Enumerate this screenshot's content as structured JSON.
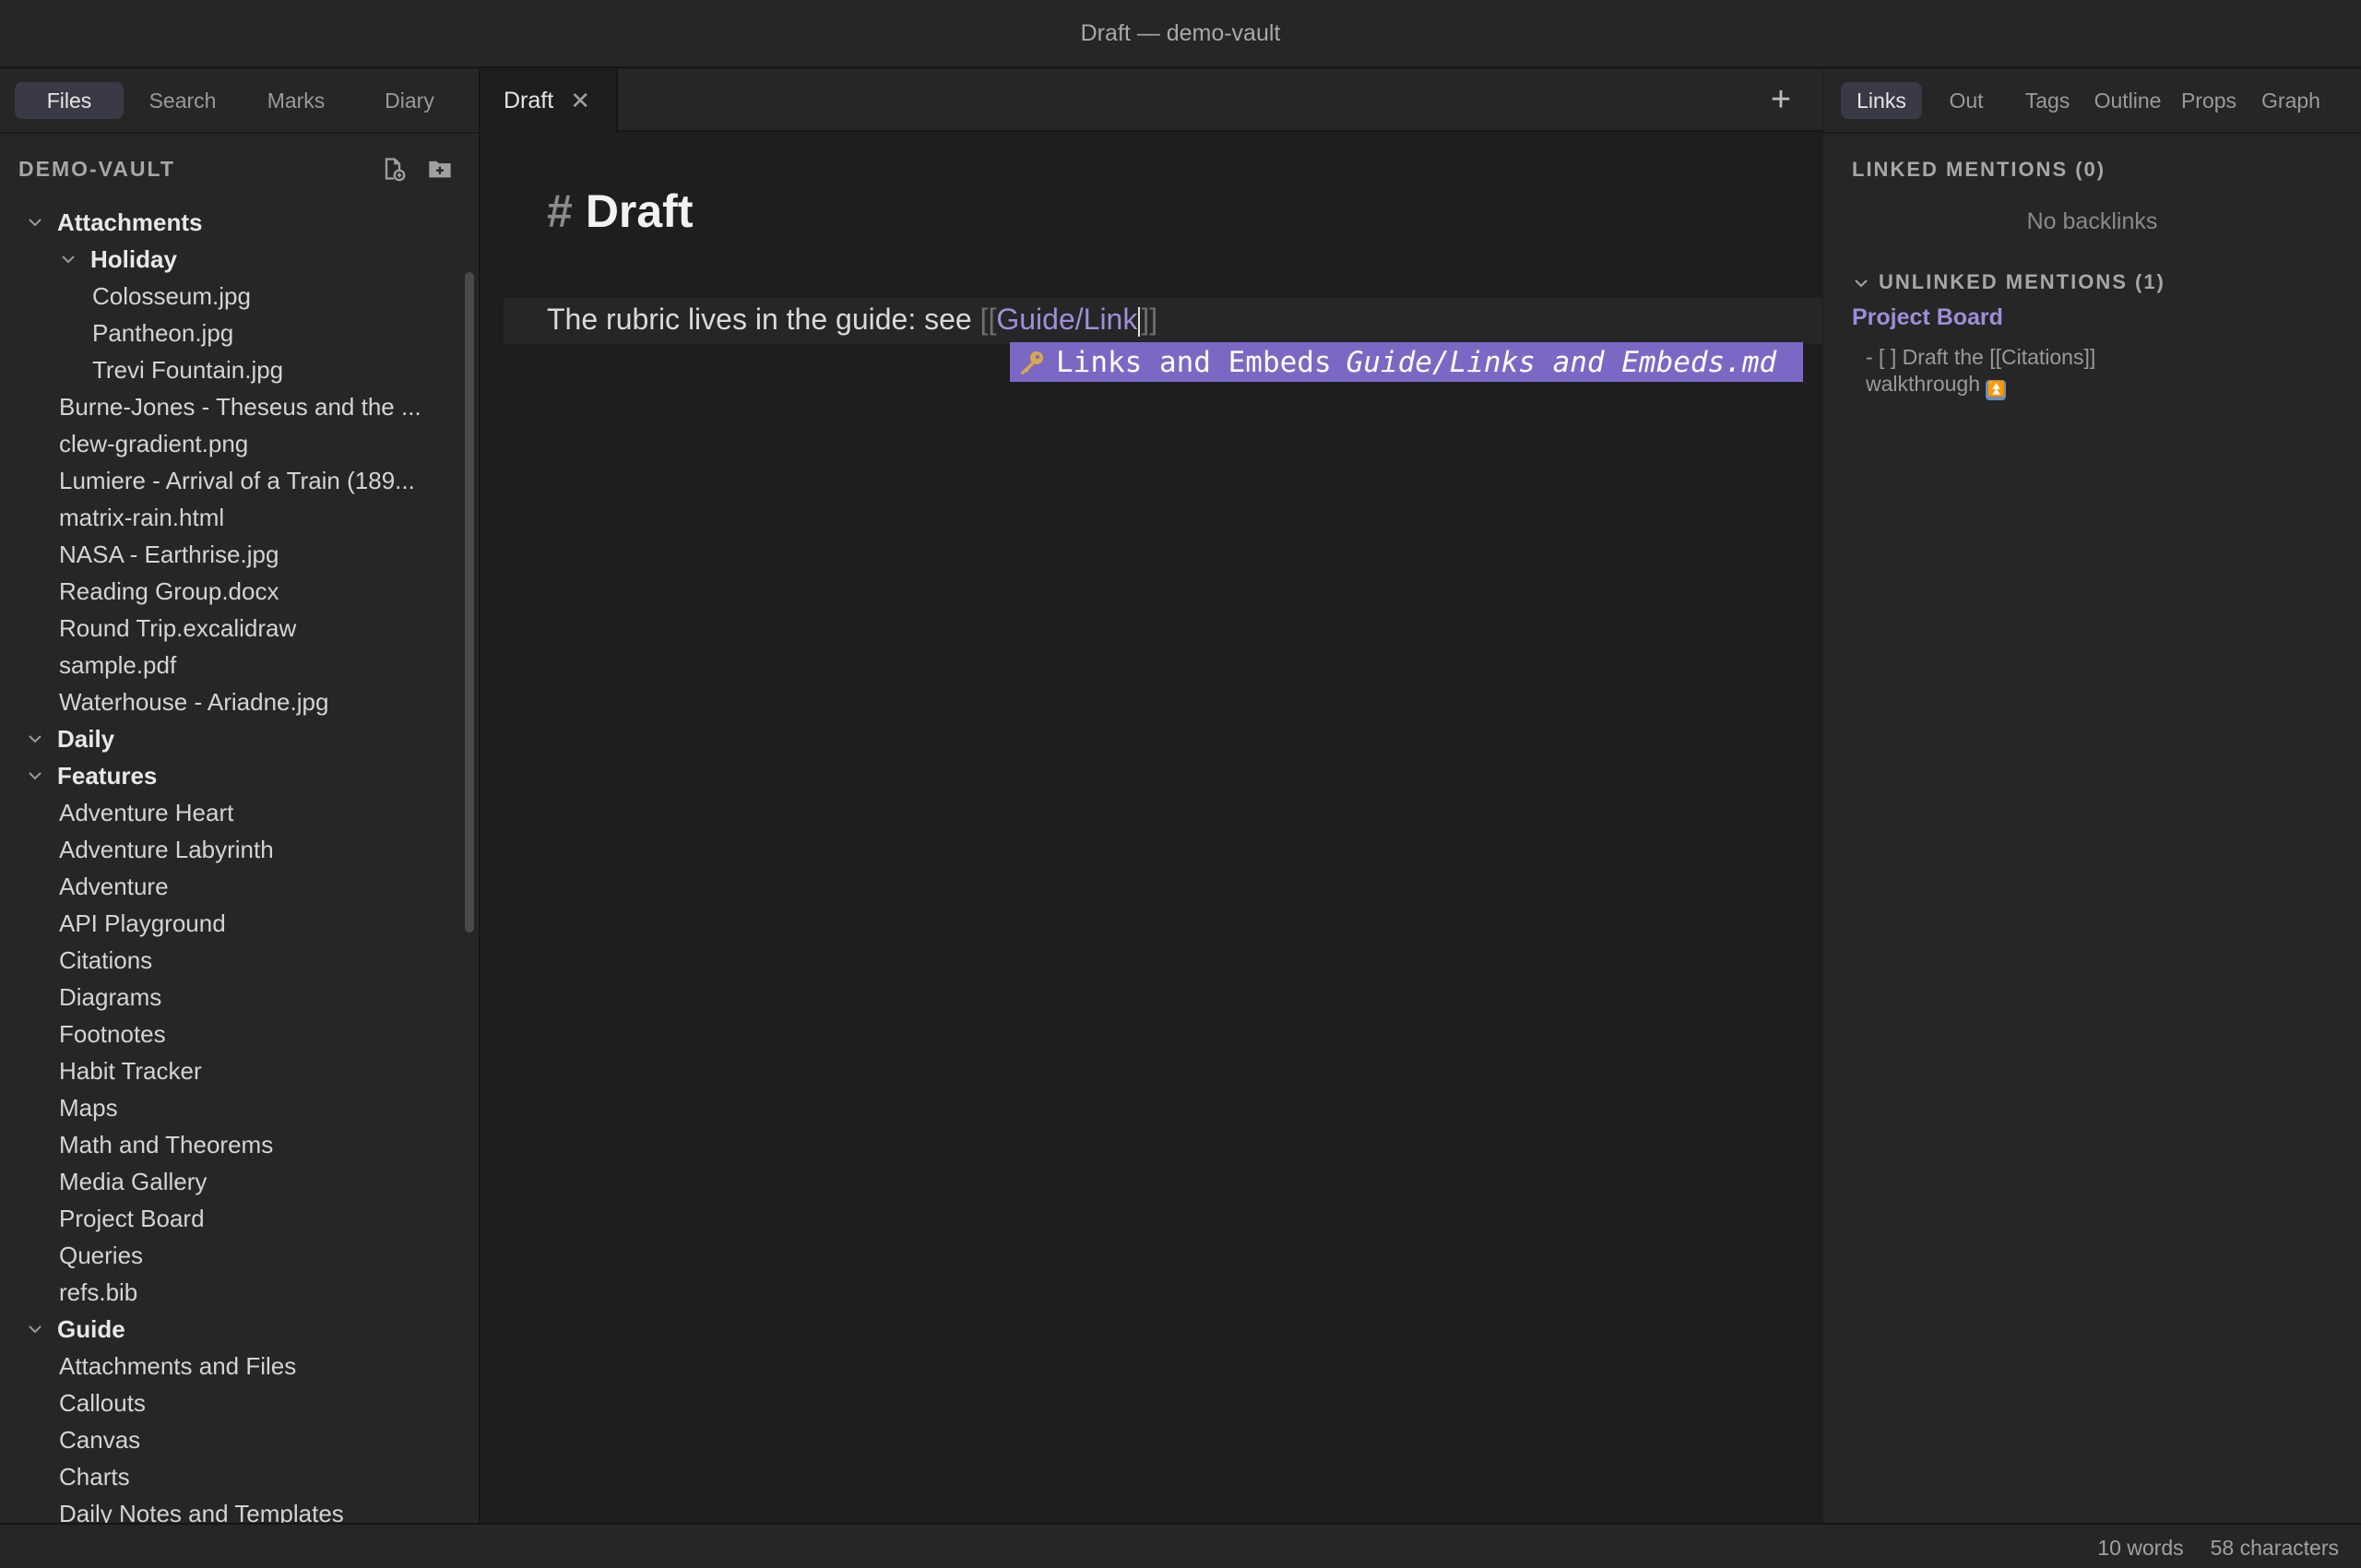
{
  "window": {
    "title": "Draft — demo-vault"
  },
  "left_sidebar": {
    "tabs": [
      {
        "label": "Files",
        "active": true
      },
      {
        "label": "Search",
        "active": false
      },
      {
        "label": "Marks",
        "active": false
      },
      {
        "label": "Diary",
        "active": false
      }
    ],
    "vault_name": "DEMO-VAULT",
    "tree": [
      {
        "label": "Attachments",
        "type": "folder",
        "depth": 0
      },
      {
        "label": "Holiday",
        "type": "folder",
        "depth": 1
      },
      {
        "label": "Colosseum.jpg",
        "type": "file",
        "depth": 2
      },
      {
        "label": "Pantheon.jpg",
        "type": "file",
        "depth": 2
      },
      {
        "label": "Trevi Fountain.jpg",
        "type": "file",
        "depth": 2
      },
      {
        "label": "Burne-Jones - Theseus and the ...",
        "type": "file",
        "depth": 1
      },
      {
        "label": "clew-gradient.png",
        "type": "file",
        "depth": 1
      },
      {
        "label": "Lumiere - Arrival of a Train (189...",
        "type": "file",
        "depth": 1
      },
      {
        "label": "matrix-rain.html",
        "type": "file",
        "depth": 1
      },
      {
        "label": "NASA - Earthrise.jpg",
        "type": "file",
        "depth": 1
      },
      {
        "label": "Reading Group.docx",
        "type": "file",
        "depth": 1
      },
      {
        "label": "Round Trip.excalidraw",
        "type": "file",
        "depth": 1
      },
      {
        "label": "sample.pdf",
        "type": "file",
        "depth": 1
      },
      {
        "label": "Waterhouse - Ariadne.jpg",
        "type": "file",
        "depth": 1
      },
      {
        "label": "Daily",
        "type": "folder",
        "depth": 0
      },
      {
        "label": "Features",
        "type": "folder",
        "depth": 0
      },
      {
        "label": "Adventure Heart",
        "type": "file",
        "depth": 1
      },
      {
        "label": "Adventure Labyrinth",
        "type": "file",
        "depth": 1
      },
      {
        "label": "Adventure",
        "type": "file",
        "depth": 1
      },
      {
        "label": "API Playground",
        "type": "file",
        "depth": 1
      },
      {
        "label": "Citations",
        "type": "file",
        "depth": 1
      },
      {
        "label": "Diagrams",
        "type": "file",
        "depth": 1
      },
      {
        "label": "Footnotes",
        "type": "file",
        "depth": 1
      },
      {
        "label": "Habit Tracker",
        "type": "file",
        "depth": 1
      },
      {
        "label": "Maps",
        "type": "file",
        "depth": 1
      },
      {
        "label": "Math and Theorems",
        "type": "file",
        "depth": 1
      },
      {
        "label": "Media Gallery",
        "type": "file",
        "depth": 1
      },
      {
        "label": "Project Board",
        "type": "file",
        "depth": 1
      },
      {
        "label": "Queries",
        "type": "file",
        "depth": 1
      },
      {
        "label": "refs.bib",
        "type": "file",
        "depth": 1
      },
      {
        "label": "Guide",
        "type": "folder",
        "depth": 0
      },
      {
        "label": "Attachments and Files",
        "type": "file",
        "depth": 1
      },
      {
        "label": "Callouts",
        "type": "file",
        "depth": 1
      },
      {
        "label": "Canvas",
        "type": "file",
        "depth": 1
      },
      {
        "label": "Charts",
        "type": "file",
        "depth": 1
      },
      {
        "label": "Daily Notes and Templates",
        "type": "file",
        "depth": 1
      }
    ]
  },
  "editor": {
    "tab_label": "Draft",
    "heading_hash": "#",
    "heading": "Draft",
    "line_prefix": "The rubric lives in the guide: see ",
    "link_open": "[[",
    "link_typed": "Guide/Link",
    "link_close": "]]",
    "suggestion": {
      "title": "Links and Embeds",
      "path": "Guide/Links and Embeds.md"
    }
  },
  "right_sidebar": {
    "tabs": [
      {
        "label": "Links",
        "active": true
      },
      {
        "label": "Out",
        "active": false
      },
      {
        "label": "Tags",
        "active": false
      },
      {
        "label": "Outline",
        "active": false
      },
      {
        "label": "Props",
        "active": false
      },
      {
        "label": "Graph",
        "active": false
      }
    ],
    "linked_title": "LINKED MENTIONS (0)",
    "no_backlinks": "No backlinks",
    "unlinked_title": "UNLINKED MENTIONS (1)",
    "mention_note": "Project Board",
    "mention_text": "- [ ] Draft the [[Citations]] walkthrough",
    "mention_badge": "⏫"
  },
  "status": {
    "words": "10 words",
    "chars": "58 characters"
  },
  "colors": {
    "accent": "#7a68c4",
    "link": "#9d8fd8",
    "background": "#1e1e1e",
    "panel": "#262626"
  }
}
